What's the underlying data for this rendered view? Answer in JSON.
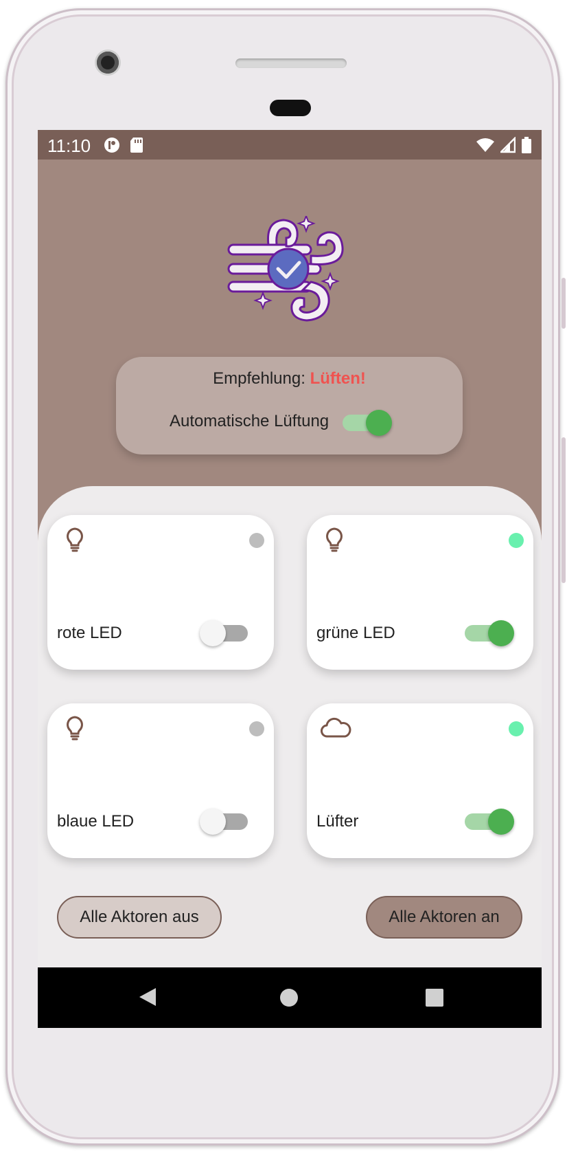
{
  "status": {
    "time": "11:10",
    "icons_left": [
      "app-notification-icon",
      "sd-card-icon"
    ],
    "icons_right": [
      "wifi-icon",
      "signal-icon",
      "battery-icon"
    ]
  },
  "header": {
    "logo_icon": "wind-check-icon"
  },
  "recommendation": {
    "label": "Empfehlung:",
    "value": "Lüften!",
    "value_color": "#ef5350",
    "auto_label": "Automatische Lüftung",
    "auto_on": true
  },
  "actuators": [
    {
      "icon": "lightbulb-icon",
      "label": "rote LED",
      "on": false,
      "status_color": "#bdbdbd"
    },
    {
      "icon": "lightbulb-icon",
      "label": "grüne LED",
      "on": true,
      "status_color": "#69f0ae"
    },
    {
      "icon": "lightbulb-icon",
      "label": "blaue LED",
      "on": false,
      "status_color": "#bdbdbd"
    },
    {
      "icon": "cloud-icon",
      "label": "Lüfter",
      "on": true,
      "status_color": "#69f0ae"
    }
  ],
  "actions": {
    "all_off": "Alle Aktoren aus",
    "all_on": "Alle Aktoren an"
  },
  "navbar": {
    "icons": [
      "back-icon",
      "home-icon",
      "recents-icon"
    ]
  },
  "colors": {
    "primary": "#a1887f",
    "primary_dark": "#795f57",
    "toggle_on": "#4caf50"
  }
}
